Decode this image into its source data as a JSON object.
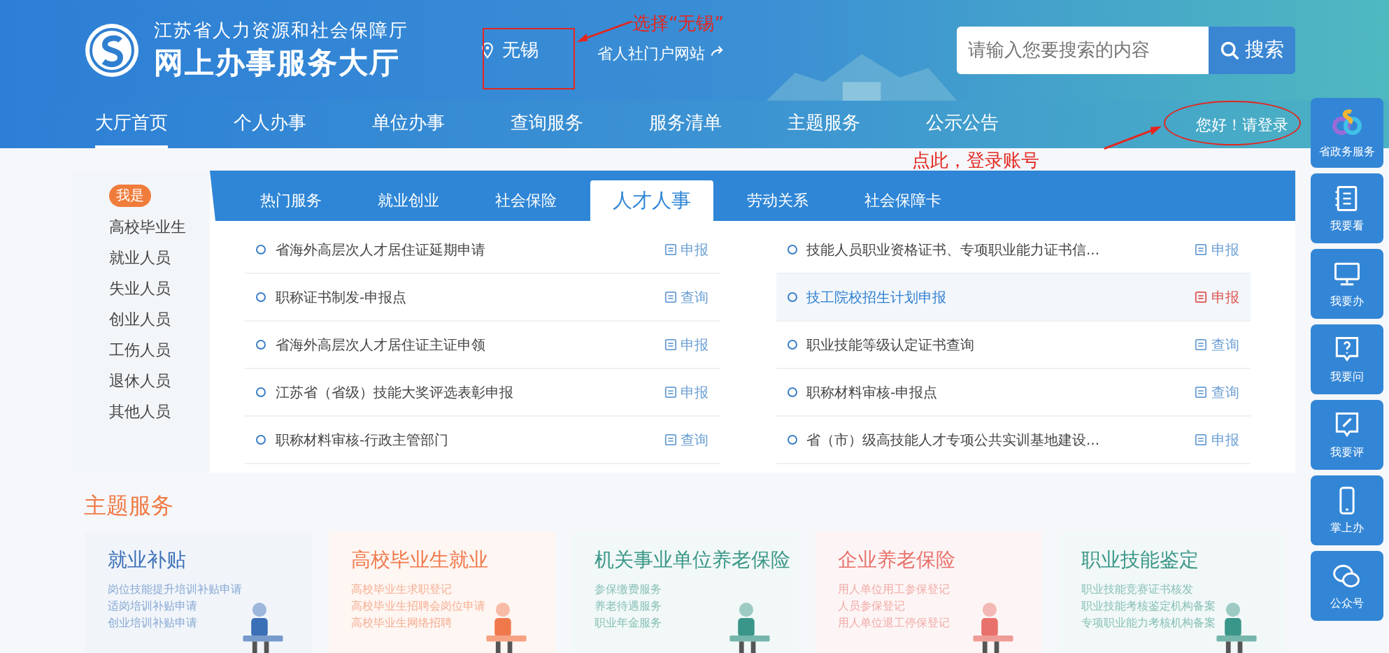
{
  "header": {
    "agency": "江苏省人力资源和社会保障厅",
    "title": "网上办事服务大厅",
    "location": "无锡",
    "portal_link": "省人社门户网站",
    "search": {
      "placeholder": "请输入您要搜索的内容",
      "button": "搜索"
    }
  },
  "nav": [
    {
      "label": "大厅首页",
      "selected": true
    },
    {
      "label": "个人办事",
      "selected": false
    },
    {
      "label": "单位办事",
      "selected": false
    },
    {
      "label": "查询服务",
      "selected": false
    },
    {
      "label": "服务清单",
      "selected": false
    },
    {
      "label": "主题服务",
      "selected": false
    },
    {
      "label": "公示公告",
      "selected": false
    }
  ],
  "login": "您好！请登录",
  "annotations": [
    "选择“无锡”",
    "点此，登录账号"
  ],
  "category_sidebar": {
    "badge": "我是",
    "items": [
      "高校毕业生",
      "就业人员",
      "失业人员",
      "创业人员",
      "工伤人员",
      "退休人员",
      "其他人员"
    ]
  },
  "service_tabs": [
    {
      "label": "热门服务",
      "selected": false
    },
    {
      "label": "就业创业",
      "selected": false
    },
    {
      "label": "社会保险",
      "selected": false
    },
    {
      "label": "人才人事",
      "selected": true
    },
    {
      "label": "劳动关系",
      "selected": false
    },
    {
      "label": "社会保障卡",
      "selected": false
    }
  ],
  "services": [
    [
      {
        "name": "省海外高层次人才居住证延期申请",
        "action": "申报",
        "highlighted": false
      },
      {
        "name": "职称证书制发-申报点",
        "action": "查询",
        "highlighted": false
      },
      {
        "name": "省海外高层次人才居住证主证申领",
        "action": "申报",
        "highlighted": false
      },
      {
        "name": "江苏省（省级）技能大奖评选表彰申报",
        "action": "申报",
        "highlighted": false
      },
      {
        "name": "职称材料审核-行政主管部门",
        "action": "查询",
        "highlighted": false
      }
    ],
    [
      {
        "name": "技能人员职业资格证书、专项职业能力证书信...",
        "action": "申报",
        "highlighted": false
      },
      {
        "name": "技工院校招生计划申报",
        "action": "申报",
        "highlighted": true
      },
      {
        "name": "职业技能等级认定证书查询",
        "action": "查询",
        "highlighted": false
      },
      {
        "name": "职称材料审核-申报点",
        "action": "查询",
        "highlighted": false
      },
      {
        "name": "省（市）级高技能人才专项公共实训基地建设...",
        "action": "申报",
        "highlighted": false
      }
    ]
  ],
  "theme_section": {
    "title": "主题服务",
    "cards": [
      {
        "title": "就业补贴",
        "color": "#3b6fb6",
        "lines": [
          "岗位技能提升培训补贴申请",
          "适岗培训补贴申请",
          "创业培训补贴申请"
        ]
      },
      {
        "title": "高校毕业生就业",
        "color": "#f0794c",
        "lines": [
          "高校毕业生求职登记",
          "高校毕业生招聘会岗位申请",
          "高校毕业生网络招聘"
        ]
      },
      {
        "title": "机关事业单位养老保险",
        "color": "#3a9688",
        "lines": [
          "参保缴费服务",
          "养老待遇服务",
          "职业年金服务"
        ]
      },
      {
        "title": "企业养老保险",
        "color": "#e8716b",
        "lines": [
          "用人单位用工参保登记",
          "人员参保登记",
          "用人单位退工停保登记"
        ]
      },
      {
        "title": "职业技能鉴定",
        "color": "#3a9688",
        "lines": [
          "职业技能竞赛证书核发",
          "职业技能考核鉴定机构备案",
          "专项职业能力考核机构备案"
        ]
      }
    ]
  },
  "float_bar": [
    "省政务服务",
    "我要看",
    "我要办",
    "我要问",
    "我要评",
    "掌上办",
    "公众号"
  ]
}
